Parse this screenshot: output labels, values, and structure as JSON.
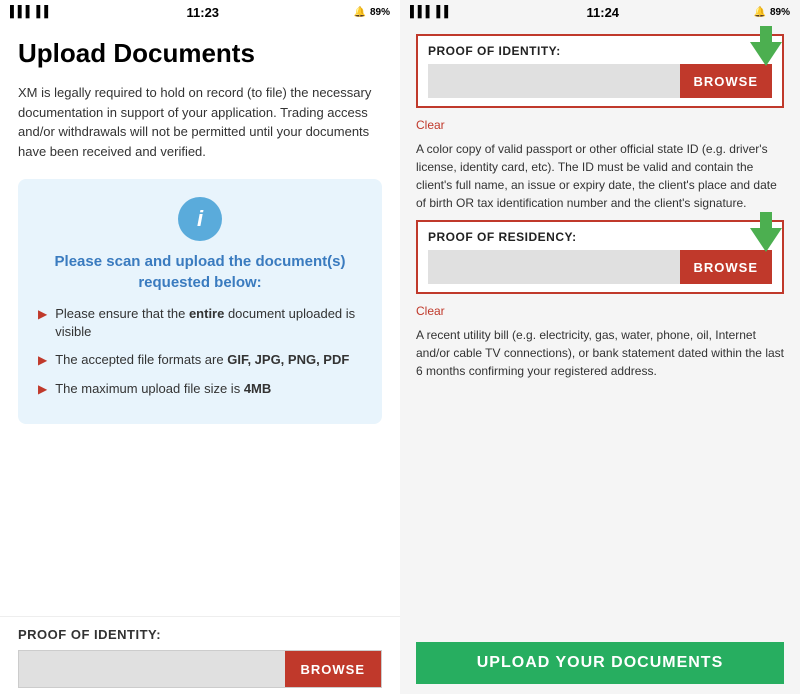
{
  "left": {
    "status_bar": {
      "signal": "▌▌▌▌",
      "wifi": "WiFi",
      "time": "11:23",
      "battery": "89%"
    },
    "title": "Upload Documents",
    "description": "XM is legally required to hold on record (to file) the necessary documentation in support of your application. Trading access and/or withdrawals will not be permitted until your documents have been received and verified.",
    "info_box": {
      "icon": "i",
      "heading": "Please scan and upload the document(s) requested below:",
      "bullets": [
        {
          "text_before": "Please ensure that the ",
          "bold": "entire",
          "text_after": " document uploaded is visible"
        },
        {
          "text_before": "The accepted file formats are ",
          "bold": "GIF, JPG, PNG, PDF",
          "text_after": ""
        },
        {
          "text_before": "The maximum upload file size is ",
          "bold": "4MB",
          "text_after": ""
        }
      ]
    },
    "bottom_label": "PROOF OF IDENTITY:",
    "browse_label": "BROWSE"
  },
  "right": {
    "status_bar": {
      "signal": "▌▌▌▌",
      "wifi": "WiFi",
      "time": "11:24",
      "battery": "89%"
    },
    "proof_identity": {
      "label": "PROOF OF IDENTITY:",
      "browse": "BROWSE",
      "clear": "Clear",
      "description": "A color copy of valid passport or other official state ID (e.g. driver's license, identity card, etc). The ID must be valid and contain the client's full name, an issue or expiry date, the client's place and date of birth OR tax identification number and the client's signature."
    },
    "proof_residency": {
      "label": "PROOF OF RESIDENCY:",
      "browse": "BROWSE",
      "clear": "Clear",
      "description": "A recent utility bill (e.g. electricity, gas, water, phone, oil, Internet and/or cable TV connections), or bank statement dated within the last 6 months confirming your registered address."
    },
    "upload_button": "UPLOAD YOUR DOCUMENTS"
  }
}
